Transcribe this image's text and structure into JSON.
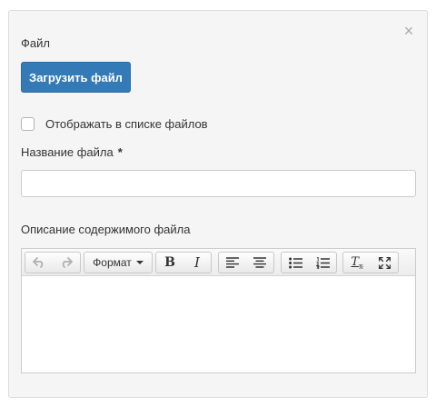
{
  "dialog": {
    "close_glyph": "×",
    "file_label": "Файл",
    "upload_button_label": "Загрузить файл",
    "show_in_list_label": "Отображать в списке файлов",
    "show_in_list_checked": false,
    "file_name_label": "Название файла",
    "required_marker": "*",
    "file_name_value": "",
    "description_label": "Описание содержимого файла"
  },
  "editor": {
    "toolbar": {
      "format_label": "Формат",
      "bold_glyph": "B",
      "italic_glyph": "I",
      "clear_format_glyph": "T",
      "clear_format_sub": "x"
    },
    "content": ""
  },
  "colors": {
    "primary_button": "#337ab7",
    "dialog_background": "#f5f5f5",
    "border": "#cccccc"
  }
}
